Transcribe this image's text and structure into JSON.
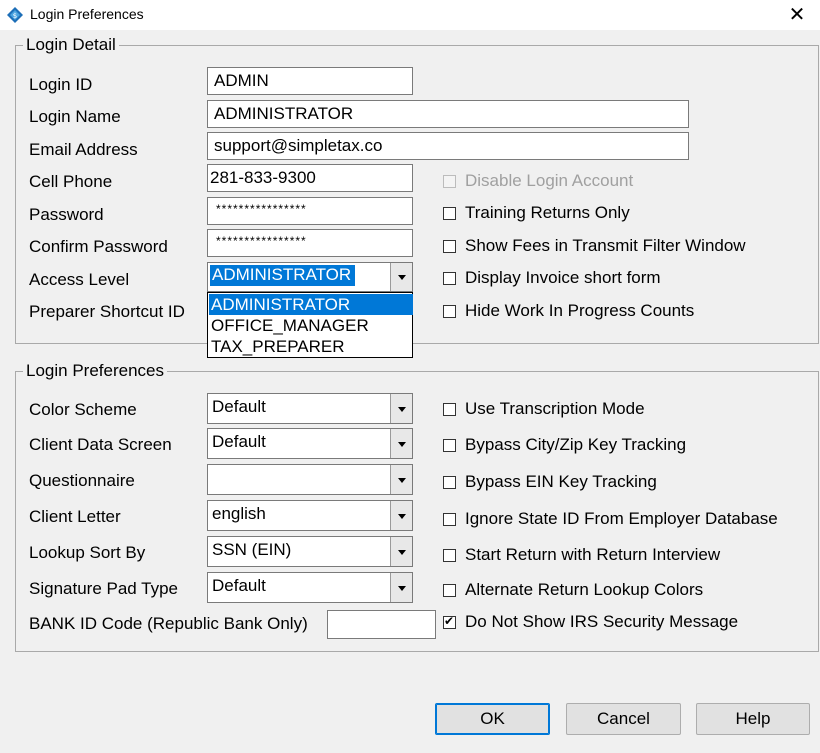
{
  "window": {
    "title": "Login Preferences",
    "close_glyph": "✕"
  },
  "login_detail": {
    "legend": "Login Detail",
    "login_id": {
      "label": "Login ID",
      "value": "ADMIN"
    },
    "login_name": {
      "label": "Login Name",
      "value": "ADMINISTRATOR"
    },
    "email": {
      "label": "Email Address",
      "value": "support@simpletax.co"
    },
    "cell_phone": {
      "label": "Cell Phone",
      "value": "281-833-9300"
    },
    "password": {
      "label": "Password",
      "value": "****************"
    },
    "confirm_password": {
      "label": "Confirm Password",
      "value": "****************"
    },
    "access_level": {
      "label": "Access Level",
      "value": "ADMINISTRATOR",
      "options": [
        "ADMINISTRATOR",
        "OFFICE_MANAGER",
        "TAX_PREPARER"
      ]
    },
    "preparer_shortcut": {
      "label": "Preparer Shortcut ID"
    },
    "checkboxes": [
      {
        "label": "Disable Login Account",
        "checked": false,
        "disabled": true
      },
      {
        "label": "Training Returns Only",
        "checked": false,
        "disabled": false
      },
      {
        "label": "Show Fees in Transmit Filter Window",
        "checked": false,
        "disabled": false
      },
      {
        "label": "Display Invoice short form",
        "checked": false,
        "disabled": false
      },
      {
        "label": "Hide Work In Progress Counts",
        "checked": false,
        "disabled": false
      }
    ]
  },
  "login_prefs": {
    "legend": "Login Preferences",
    "color_scheme": {
      "label": "Color Scheme",
      "value": "Default"
    },
    "client_data_screen": {
      "label": "Client Data Screen",
      "value": "Default"
    },
    "questionnaire": {
      "label": "Questionnaire",
      "value": ""
    },
    "client_letter": {
      "label": "Client Letter",
      "value": "english"
    },
    "lookup_sort_by": {
      "label": "Lookup Sort By",
      "value": "SSN (EIN)"
    },
    "signature_pad_type": {
      "label": "Signature Pad Type",
      "value": "Default"
    },
    "bank_id_code": {
      "label": "BANK ID Code (Republic Bank Only)",
      "value": ""
    },
    "checkboxes": [
      {
        "label": "Use Transcription Mode",
        "checked": false
      },
      {
        "label": "Bypass City/Zip Key Tracking",
        "checked": false
      },
      {
        "label": "Bypass EIN Key Tracking",
        "checked": false
      },
      {
        "label": "Ignore State ID From Employer Database",
        "checked": false
      },
      {
        "label": "Start Return with Return Interview",
        "checked": false
      },
      {
        "label": "Alternate Return Lookup Colors",
        "checked": false
      },
      {
        "label": "Do Not Show IRS Security Message",
        "checked": true
      }
    ]
  },
  "buttons": {
    "ok": "OK",
    "cancel": "Cancel",
    "help": "Help"
  },
  "colors": {
    "accent": "#0078d7",
    "background": "#f0f0f0",
    "icon": "#1d6fb8"
  },
  "icons": {
    "app": "diamond-logo-icon",
    "close": "close-icon",
    "dropdown": "chevron-down-icon"
  }
}
